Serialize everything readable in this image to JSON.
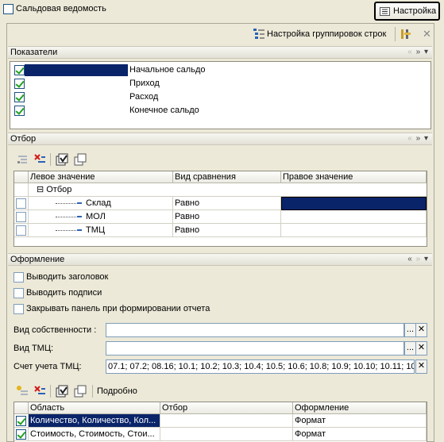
{
  "window": {
    "title_checkbox_label": "Сальдовая ведомость",
    "settings_button": "Настройка"
  },
  "toolbar": {
    "grouping_settings": "Настройка группировок строк",
    "close_glyph": "✕"
  },
  "nav": {
    "prev": "«",
    "next": "»",
    "menu": "▾"
  },
  "indicators": {
    "title": "Показатели",
    "items": [
      {
        "label": "Начальное сальдо",
        "checked": true
      },
      {
        "label": "Приход",
        "checked": true
      },
      {
        "label": "Расход",
        "checked": true
      },
      {
        "label": "Конечное сальдо",
        "checked": true
      }
    ]
  },
  "filter": {
    "title": "Отбор",
    "columns": [
      "Левое значение",
      "Вид сравнения",
      "Правое значение"
    ],
    "group_label": "Отбор",
    "group_toggle": "⊟",
    "rows": [
      {
        "left": "Склад",
        "cmp": "Равно",
        "right": ""
      },
      {
        "left": "МОЛ",
        "cmp": "Равно",
        "right": ""
      },
      {
        "left": "ТМЦ",
        "cmp": "Равно",
        "right": ""
      }
    ]
  },
  "design": {
    "title": "Оформление",
    "options": [
      {
        "label": "Выводить заголовок",
        "checked": false
      },
      {
        "label": "Выводить подписи",
        "checked": false
      },
      {
        "label": "Закрывать панель при формировании отчета",
        "checked": false
      }
    ],
    "fields": [
      {
        "label": "Вид собственности :",
        "value": ""
      },
      {
        "label": "Вид ТМЦ:",
        "value": ""
      },
      {
        "label": "Счет учета ТМЦ:",
        "value": "07.1; 07.2; 08.16; 10.1; 10.2; 10.3; 10.4; 10.5; 10.6; 10.8; 10.9; 10.10; 10.11; 10..."
      }
    ],
    "ellipsis": "...",
    "clear": "✕",
    "details_label": "Подробно",
    "columns": [
      "Область",
      "Отбор",
      "Оформление"
    ],
    "rows": [
      {
        "area": "Количество, Количество, Кол...",
        "filter": "",
        "format": "Формат",
        "checked": true
      },
      {
        "area": "Стоимость, Стоимость, Стои...",
        "filter": "",
        "format": "Формат",
        "checked": true
      }
    ]
  },
  "colors": {
    "selection": "#0a246a",
    "panel": "#ece9d8",
    "border": "#8f8d80"
  }
}
